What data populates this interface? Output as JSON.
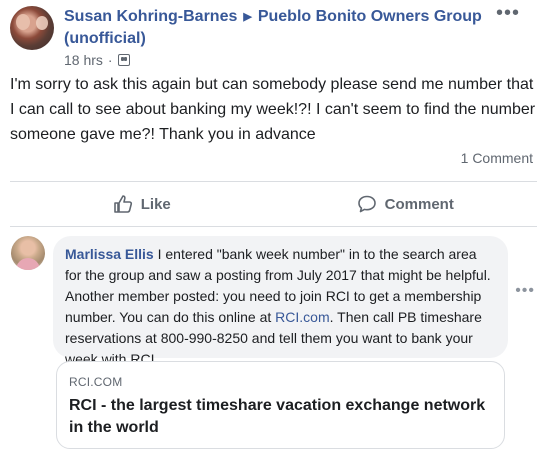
{
  "post": {
    "author": "Susan Kohring-Barnes",
    "group_name": "Pueblo Bonito Owners Group (unofficial)",
    "timestamp": "18 hrs",
    "separator": "·",
    "icon_group": "group-audience-icon",
    "body": "I'm sorry to ask this again but can somebody please send me number that I can call to see about banking my week!?! I can't seem to find the number someone gave me?! Thank you in advance",
    "comment_count": "1 Comment"
  },
  "actions": {
    "like_label": "Like",
    "comment_label": "Comment"
  },
  "comment": {
    "author": "Marlissa Ellis",
    "text_before_link": " I entered \"bank week number\" in to the search area for the group and saw a posting from July 2017 that might be helpful. Another member posted: you need to join RCI to get a membership number. You can do this online at ",
    "link_text": "RCI.com",
    "text_after_link": ". Then call PB timeshare reservations at 800-990-8250 and tell them you want to bank your week with RCI."
  },
  "link_preview": {
    "domain": "RCI.COM",
    "title": "RCI - the largest timeshare vacation exchange network in the world"
  },
  "colors": {
    "link_blue": "#385898",
    "secondary_text": "#606770",
    "bubble_bg": "#f2f3f5"
  }
}
